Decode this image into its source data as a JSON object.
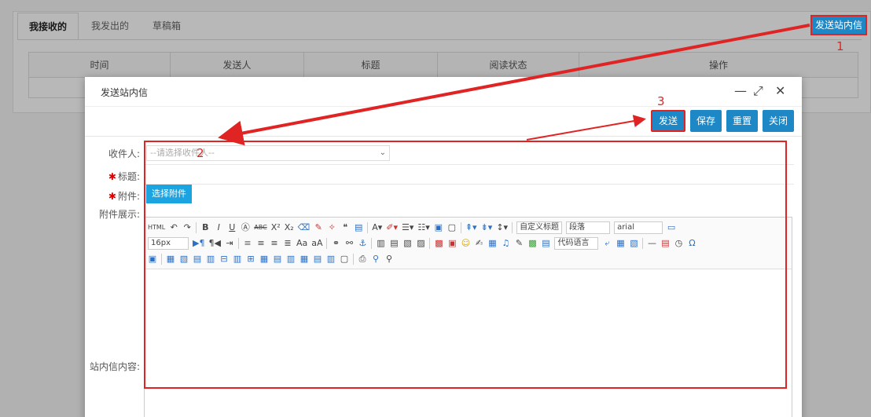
{
  "background": {
    "tabs": [
      "我接收的",
      "我发出的",
      "草稿箱"
    ],
    "columns": [
      "时间",
      "发送人",
      "标题",
      "阅读状态",
      "操作"
    ],
    "send_button": "发送站内信"
  },
  "markers": {
    "m1": "1",
    "m2": "2",
    "m3": "3"
  },
  "modal": {
    "title": "发送站内信",
    "minimize": "—",
    "maximize": "⤢",
    "close": "✕",
    "actions": {
      "send": "发送",
      "save": "保存",
      "reset": "重置",
      "close": "关闭"
    },
    "labels": {
      "recipient": "收件人:",
      "subject": "标题:",
      "attachment": "附件:",
      "attachment_display": "附件展示:",
      "content": "站内信内容:"
    },
    "required_mark": "✱",
    "recipient_placeholder": "--请选择收件人--",
    "attach_button": "选择附件"
  },
  "editor": {
    "font_size": "16px",
    "heading_select": "自定义标题",
    "paragraph_select": "段落",
    "font_select": "arial",
    "code_select": "代码语言"
  },
  "colors": {
    "accent": "#1e88c7",
    "annotation": "#e02424"
  }
}
